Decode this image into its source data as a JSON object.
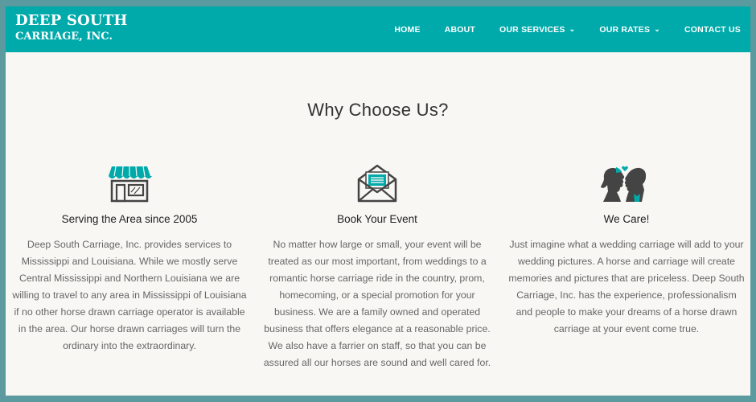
{
  "brand": {
    "line1": "DEEP SOUTH",
    "line2": "CARRIAGE, INC."
  },
  "nav": {
    "items": [
      {
        "label": "HOME"
      },
      {
        "label": "ABOUT"
      },
      {
        "label": "OUR SERVICES"
      },
      {
        "label": "OUR RATES"
      },
      {
        "label": "CONTACT US"
      }
    ]
  },
  "section": {
    "title": "Why Choose Us?"
  },
  "features": [
    {
      "icon": "storefront-icon",
      "title": "Serving the Area since 2005",
      "text": "Deep South Carriage, Inc. provides services to Mississippi and Louisiana. While we mostly serve Central Mississippi and Northern Louisiana we are willing to travel to any area in Mississippi of Louisiana if no other horse drawn carriage operator is available in the area. Our horse drawn carriages will turn the ordinary into the extraordinary."
    },
    {
      "icon": "envelope-icon",
      "title": "Book Your Event",
      "text": "No matter how large or small, your event will be treated as our most important, from weddings to a romantic horse carriage ride in the country, prom, homecoming, or a special promotion for your business. We are a family owned and operated business that offers elegance at a reasonable price. We also have a farrier on staff, so that you can be assured all our horses are sound and well cared for."
    },
    {
      "icon": "couple-icon",
      "title": "We Care!",
      "text": "Just imagine what a wedding carriage will add to your wedding pictures. A horse and carriage will create memories and pictures that are priceless. Deep South Carriage, Inc. has the experience, professionalism and people to make your dreams of a horse drawn carriage at your event come true."
    }
  ],
  "colors": {
    "accent": "#00aaaa",
    "border": "#5b9a9e",
    "page_bg": "#f8f7f4",
    "heading": "#333333",
    "body_text": "#666666",
    "icon_dark": "#444444"
  }
}
